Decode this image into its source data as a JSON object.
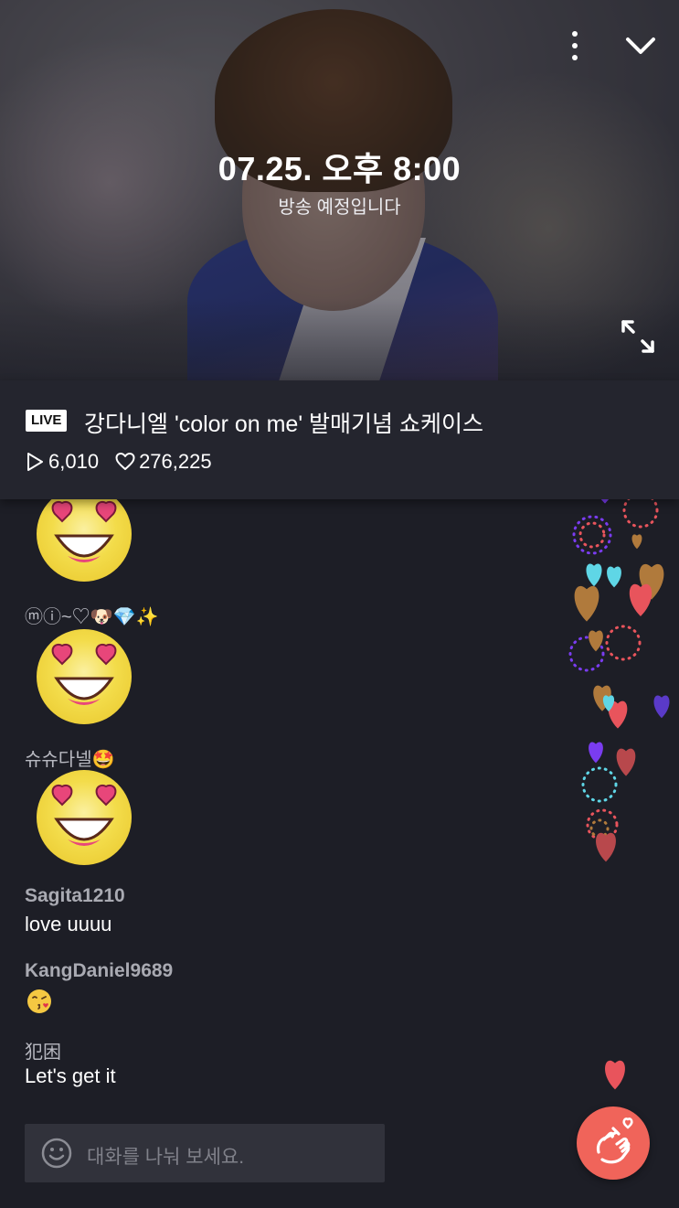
{
  "player": {
    "schedule_time": "07.25. 오후 8:00",
    "schedule_sub": "방송 예정입니다",
    "icons": [
      "more-vertical-icon",
      "chevron-down-icon",
      "expand-icon"
    ]
  },
  "info": {
    "live_badge": "LIVE",
    "title": "강다니엘 'color on me' 발매기념 쇼케이스",
    "play_count": "6,010",
    "like_count": "276,225"
  },
  "chat": {
    "messages": [
      {
        "user": "",
        "type": "sticker",
        "sticker": "heart-eyes-face"
      },
      {
        "user": "ⓜⓘ~♡🐶💎✨",
        "type": "sticker",
        "sticker": "heart-eyes-face"
      },
      {
        "user": "슈슈다넬🤩",
        "type": "sticker",
        "sticker": "heart-eyes-face"
      },
      {
        "user": "Sagita1210",
        "type": "text",
        "text": "love uuuu"
      },
      {
        "user": "KangDaniel9689",
        "type": "emoji",
        "emoji": "😘"
      },
      {
        "user": "犯困",
        "type": "text",
        "text": "Let's get it"
      }
    ]
  },
  "input": {
    "placeholder": "대화를 나눠 보세요.",
    "icon": "smile-icon"
  },
  "actions": {
    "heart_button_icon": "finger-heart-icon"
  },
  "colors": {
    "background": "#1d1e26",
    "panel": "#24252e",
    "accent": "#f0645a",
    "heart_purple": "#7a3cf0",
    "heart_brown": "#b07a3c",
    "heart_red": "#e8545c",
    "heart_cyan": "#5fd6e6"
  }
}
